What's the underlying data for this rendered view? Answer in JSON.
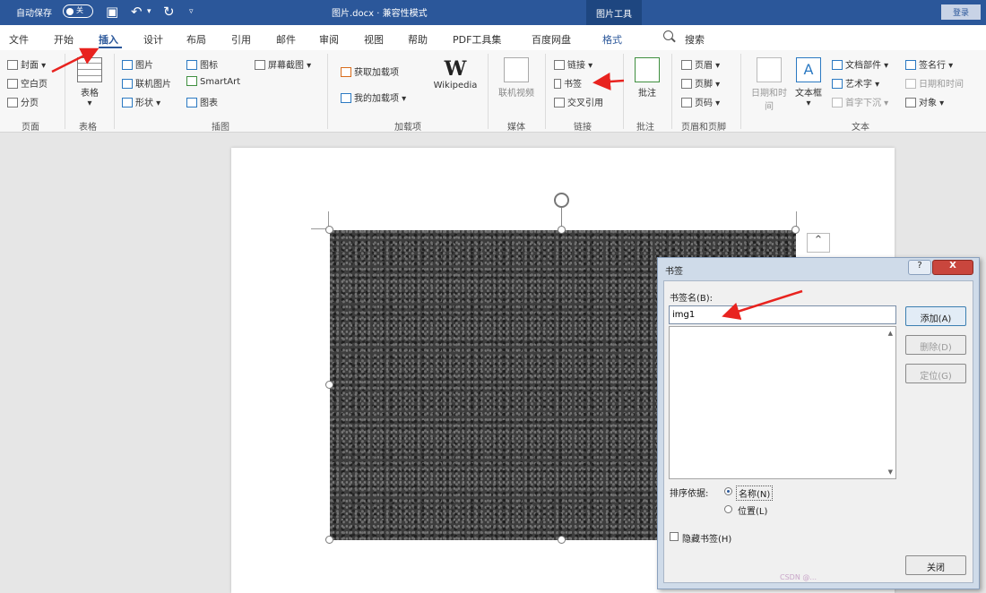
{
  "titlebar": {
    "autosave_label": "自动保存",
    "autosave_state": "关",
    "document_title": "图片.docx · 兼容性模式",
    "contextual_tab": "图片工具",
    "signin_label": "登录"
  },
  "tabs": [
    {
      "label": "文件"
    },
    {
      "label": "开始"
    },
    {
      "label": "插入"
    },
    {
      "label": "设计"
    },
    {
      "label": "布局"
    },
    {
      "label": "引用"
    },
    {
      "label": "邮件"
    },
    {
      "label": "审阅"
    },
    {
      "label": "视图"
    },
    {
      "label": "帮助"
    },
    {
      "label": "PDF工具集"
    },
    {
      "label": "百度网盘"
    },
    {
      "label": "格式"
    }
  ],
  "search_label": "搜索",
  "ribbon": {
    "pages": {
      "cover": "封面",
      "blank": "空白页",
      "break": "分页",
      "group": "页面"
    },
    "table": {
      "label": "表格",
      "group": "表格"
    },
    "illustrations": {
      "picture": "图片",
      "online_picture": "联机图片",
      "shapes": "形状",
      "icons": "图标",
      "smartart": "SmartArt",
      "chart": "图表",
      "screenshot": "屏幕截图",
      "group": "插图"
    },
    "addins": {
      "get": "获取加载项",
      "mine": "我的加载项",
      "wikipedia": "Wikipedia",
      "group": "加载项"
    },
    "media": {
      "online_video": "联机视频",
      "group": "媒体"
    },
    "links": {
      "link": "链接",
      "bookmark": "书签",
      "cross_ref": "交叉引用",
      "group": "链接"
    },
    "comments": {
      "comment": "批注",
      "group": "批注"
    },
    "header_footer": {
      "header": "页眉",
      "footer": "页脚",
      "page_number": "页码",
      "group": "页眉和页脚"
    },
    "text": {
      "date_time": "日期和时间",
      "text_box": "文本框",
      "doc_parts": "文档部件",
      "wordart": "艺术字",
      "drop_cap": "首字下沉",
      "signature": "签名行",
      "datetime2": "日期和时间",
      "object": "对象",
      "group": "文本"
    }
  },
  "dialog": {
    "title": "书签",
    "help": "?",
    "close": "X",
    "name_label": "书签名(B):",
    "name_value": "img1",
    "buttons": {
      "add": "添加(A)",
      "delete": "删除(D)",
      "goto": "定位(G)",
      "close": "关闭"
    },
    "sort_label": "排序依据:",
    "sort_name": "名称(N)",
    "sort_location": "位置(L)",
    "hidden_label": "隐藏书签(H)"
  },
  "watermark": "CSDN @..."
}
